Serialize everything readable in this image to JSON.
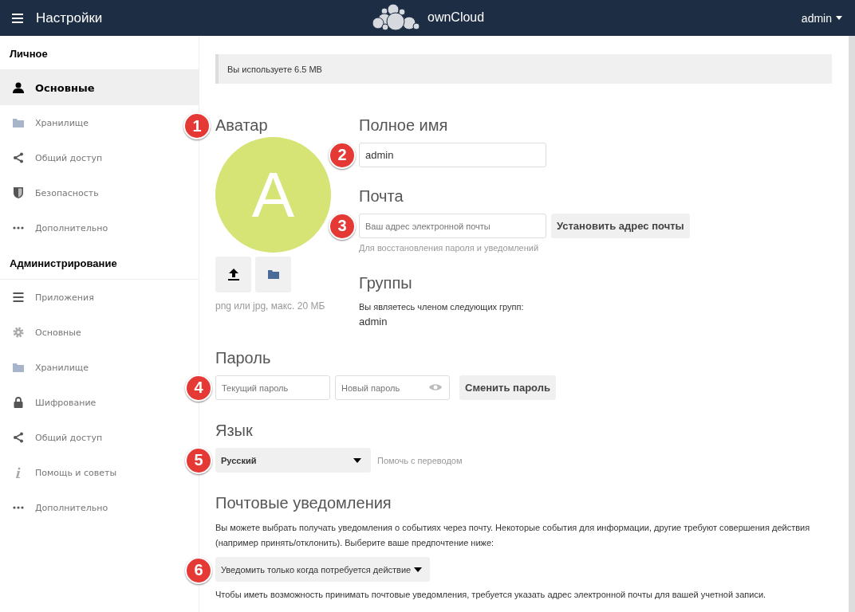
{
  "header": {
    "title": "Настройки",
    "logo_text": "ownCloud",
    "user": "admin"
  },
  "sidebar": {
    "sections": [
      {
        "title": "Личное",
        "items": [
          {
            "label": "Основные",
            "selected": true
          },
          {
            "label": "Хранилище",
            "selected": false
          },
          {
            "label": "Общий доступ",
            "selected": false
          },
          {
            "label": "Безопасность",
            "selected": false
          },
          {
            "label": "Дополнительно",
            "selected": false
          }
        ]
      },
      {
        "title": "Администрирование",
        "items": [
          {
            "label": "Приложения",
            "selected": false
          },
          {
            "label": "Основные",
            "selected": false
          },
          {
            "label": "Хранилище",
            "selected": false
          },
          {
            "label": "Шифрование",
            "selected": false
          },
          {
            "label": "Общий доступ",
            "selected": false
          },
          {
            "label": "Помощь и советы",
            "selected": false
          },
          {
            "label": "Дополнительно",
            "selected": false
          }
        ]
      }
    ]
  },
  "quota": "Вы используете 6.5 MB",
  "avatar": {
    "marker": "1",
    "heading": "Аватар",
    "initial": "A",
    "hint": "png или jpg, макс. 20 МБ"
  },
  "full_name": {
    "marker": "2",
    "heading": "Полное имя",
    "value": "admin"
  },
  "email": {
    "marker": "3",
    "heading": "Почта",
    "placeholder": "Ваш адрес электронной почты",
    "button": "Установить адрес почты",
    "hint": "Для восстановления пароля и уведомлений"
  },
  "groups": {
    "heading": "Группы",
    "text": "Вы являетесь членом следующих групп:",
    "value": "admin"
  },
  "password": {
    "marker": "4",
    "heading": "Пароль",
    "current_placeholder": "Текущий пароль",
    "new_placeholder": "Новый пароль",
    "button": "Сменить пароль"
  },
  "language": {
    "marker": "5",
    "heading": "Язык",
    "value": "Русский",
    "link": "Помочь с переводом"
  },
  "notifications": {
    "marker": "6",
    "heading": "Почтовые уведомления",
    "text": "Вы можете выбрать получать уведомления о событиях через почту. Некоторые события для информации, другие требуют совершения действия (например принять/отклонить). Выберите ваше предпочтение ниже:",
    "option": "Уведомить только когда потребуется действие",
    "note": "Чтобы иметь возможность принимать почтовые уведомления, требуется указать адрес электронной почты для вашей учетной записи."
  }
}
